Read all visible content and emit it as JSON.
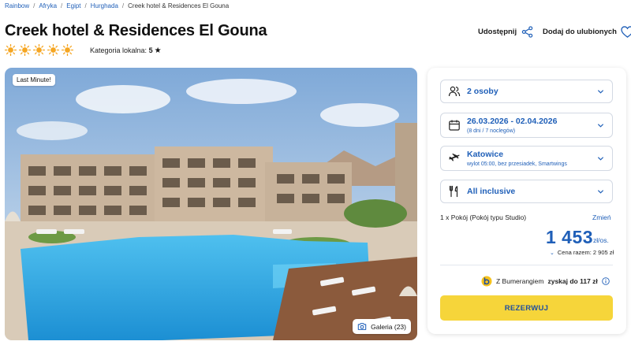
{
  "breadcrumb": {
    "items": [
      "Rainbow",
      "Afryka",
      "Egipt",
      "Hurghada"
    ],
    "current": "Creek hotel & Residences El Gouna",
    "separator": "/"
  },
  "hotel": {
    "title": "Creek hotel & Residences El Gouna",
    "rating_suns": 5,
    "local_category_label": "Kategoria lokalna:",
    "local_category_value": "5"
  },
  "actions": {
    "share_label": "Udostępnij",
    "favorite_label": "Dodaj do ulubionych"
  },
  "hero": {
    "badge": "Last Minute!",
    "gallery_label": "Galeria (23)"
  },
  "booking": {
    "persons": "2 osoby",
    "dates_main": "26.03.2026 - 02.04.2026",
    "dates_sub": "(8 dni / 7 noclegów)",
    "departure_main": "Katowice",
    "departure_sub": "wylot 05:00, bez przesiadek, Smartwings",
    "board": "All inclusive",
    "room_label": "1 x Pokój  (Pokój typu Studio)",
    "change_label": "Zmień",
    "price": "1 453",
    "price_unit": "zł/os.",
    "total_label": "Cena razem: 2 905 zł",
    "bumerang_prefix": "Z Bumerangiem",
    "bumerang_bold": "zyskaj do 117 zł",
    "reserve_label": "REZERWUJ"
  },
  "colors": {
    "link_blue": "#1f5fb8",
    "sun_orange": "#f5a623",
    "reserve_yellow": "#f6d53a",
    "pool_blue": "#2aa8e6"
  },
  "icons": {
    "share": "share-icon",
    "favorite": "heart-icon",
    "gallery": "camera-icon",
    "persons": "users-icon",
    "dates": "calendar-icon",
    "departure": "plane-icon",
    "board": "cutlery-icon",
    "info": "info-icon",
    "bumerang": "bumerang-logo-icon"
  }
}
